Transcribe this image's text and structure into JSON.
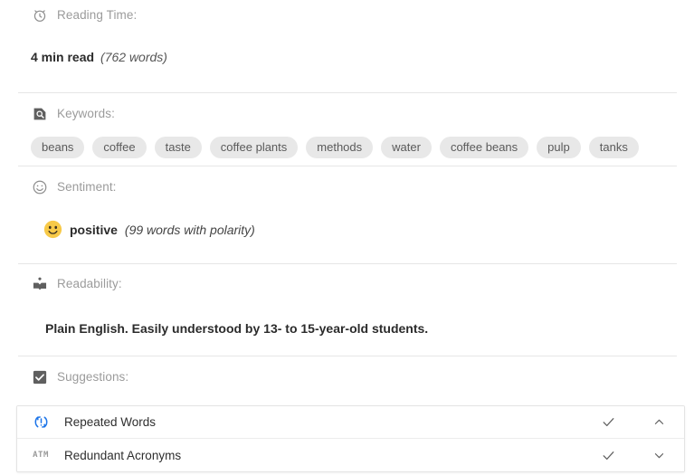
{
  "sections": {
    "reading_time": {
      "icon": "alarm-clock-icon",
      "label": "Reading Time:",
      "value": "4 min read",
      "detail": "(762 words)"
    },
    "keywords": {
      "icon": "keyword-search-icon",
      "label": "Keywords:",
      "chips": [
        "beans",
        "coffee",
        "taste",
        "coffee plants",
        "methods",
        "water",
        "coffee beans",
        "pulp",
        "tanks"
      ]
    },
    "sentiment": {
      "icon": "smiley-face-icon",
      "label": "Sentiment:",
      "emoji": "slightly-smiling-face-emoji",
      "value": "positive",
      "detail": "(99 words with polarity)",
      "emoji_color": "#f7c948"
    },
    "readability": {
      "icon": "open-book-icon",
      "label": "Readability:",
      "value": "Plain English. Easily understood by 13- to 15-year-old students."
    },
    "suggestions": {
      "icon": "checkbox-checked-icon",
      "label": "Suggestions:",
      "rows": [
        {
          "icon": "repeat-warning-icon",
          "icon_color": "#1a73e8",
          "name": "Repeated Words",
          "accept_icon": "check-icon",
          "toggle_icon": "chevron-up-icon"
        },
        {
          "icon": "atm-acronym-icon",
          "icon_color": "#9a9a9a",
          "icon_text": "ATM",
          "name": "Redundant Acronyms",
          "accept_icon": "check-icon",
          "toggle_icon": "chevron-down-icon"
        }
      ]
    }
  },
  "colors": {
    "label_gray": "#9b9b9b",
    "divider": "#e6e6e6",
    "chip_bg": "#e8e8e8",
    "accent_blue": "#1a73e8"
  }
}
